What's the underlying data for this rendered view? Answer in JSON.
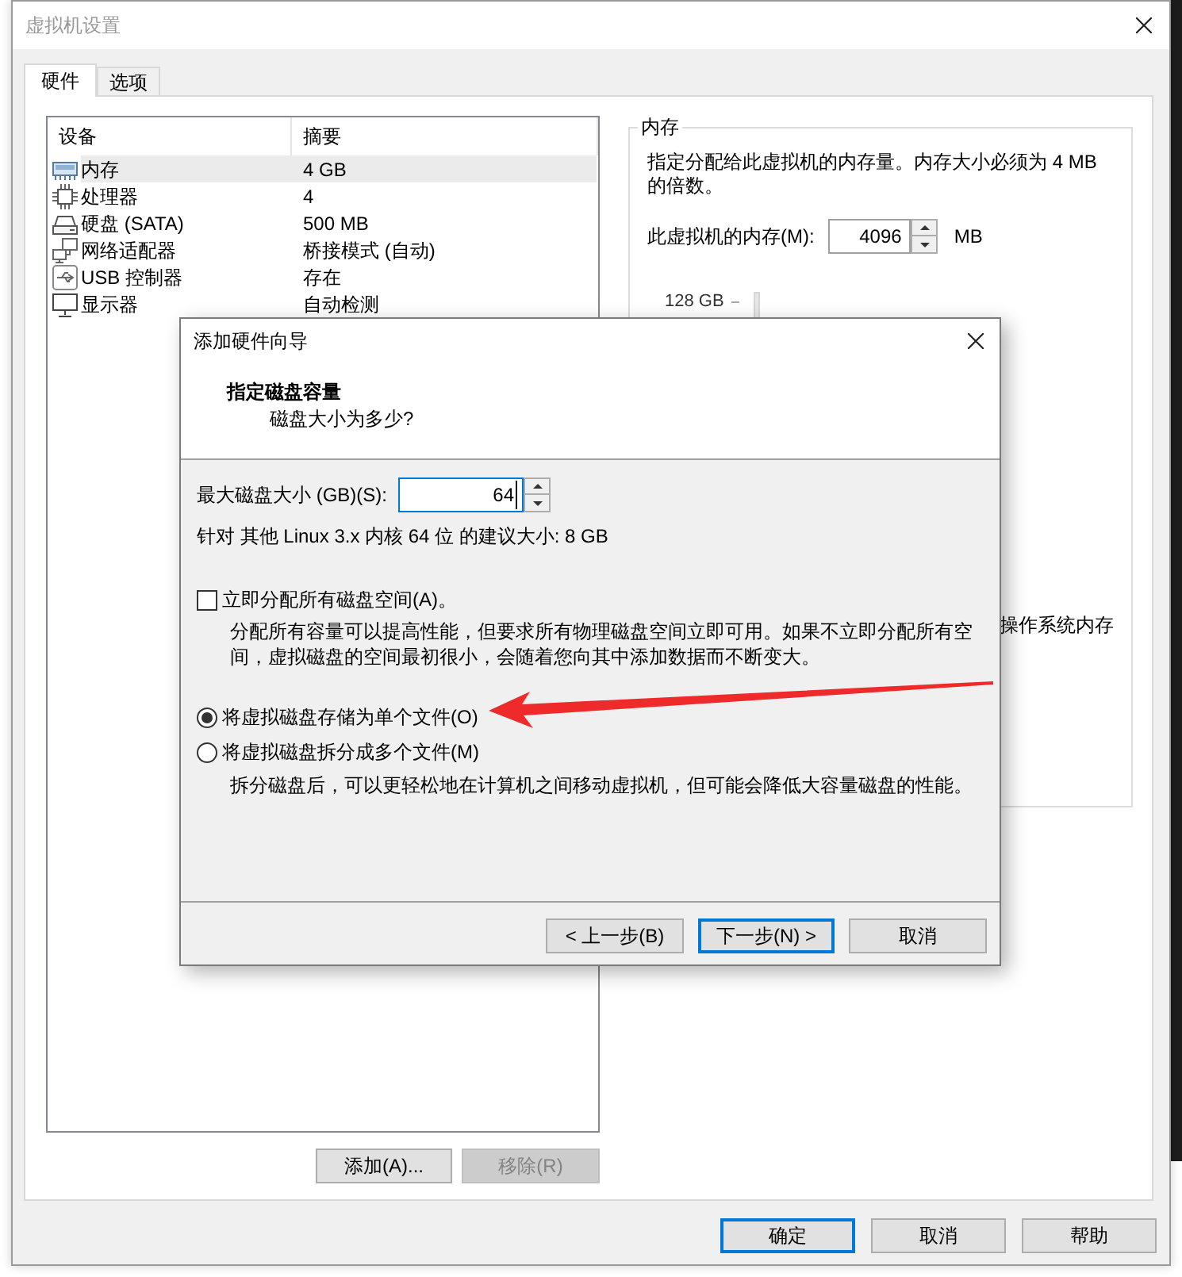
{
  "window": {
    "title": "虚拟机设置"
  },
  "tabs": [
    {
      "label": "硬件",
      "selected": true
    },
    {
      "label": "选项",
      "selected": false
    }
  ],
  "device_table": {
    "columns": [
      "设备",
      "摘要"
    ],
    "rows": [
      {
        "kind": "memory",
        "device": "内存",
        "summary": "4 GB",
        "selected": true
      },
      {
        "kind": "processor",
        "device": "处理器",
        "summary": "4",
        "selected": false
      },
      {
        "kind": "disk",
        "device": "硬盘 (SATA)",
        "summary": "500 MB",
        "selected": false
      },
      {
        "kind": "network",
        "device": "网络适配器",
        "summary": "桥接模式 (自动)",
        "selected": false
      },
      {
        "kind": "usb",
        "device": "USB 控制器",
        "summary": "存在",
        "selected": false
      },
      {
        "kind": "display",
        "device": "显示器",
        "summary": "自动检测",
        "selected": false
      }
    ]
  },
  "device_buttons": [
    {
      "label": "添加(A)...",
      "disabled": false
    },
    {
      "label": "移除(R)",
      "disabled": true
    }
  ],
  "memory_panel": {
    "title": "内存",
    "description": "指定分配给此虚拟机的内存量。内存大小必须为 4 MB 的倍数。",
    "field_label": "此虚拟机的内存(M):",
    "field": {
      "value": "4096",
      "focused": false
    },
    "unit": "MB",
    "scale_label": "128 GB",
    "note": "操作系统内存"
  },
  "buttons": [
    {
      "label": "确定",
      "default": true
    },
    {
      "label": "取消",
      "default": false
    },
    {
      "label": "帮助",
      "default": false
    }
  ],
  "dialog": {
    "title": "添加硬件向导",
    "heading": "指定磁盘容量",
    "subheading": "磁盘大小为多少?",
    "size_label": "最大磁盘大小 (GB)(S):",
    "size_field": {
      "value": "64",
      "focused": true
    },
    "recommendation": "针对 其他 Linux 3.x 内核 64 位 的建议大小: 8 GB",
    "allocate": {
      "label": "立即分配所有磁盘空间(A)。",
      "checked": false,
      "description": "分配所有容量可以提高性能，但要求所有物理磁盘空间立即可用。如果不立即分配所有空间，虚拟磁盘的空间最初很小，会随着您向其中添加数据而不断变大。"
    },
    "storage_options": [
      {
        "label": "将虚拟磁盘存储为单个文件(O)",
        "selected": true
      },
      {
        "label": "将虚拟磁盘拆分成多个文件(M)",
        "selected": false,
        "description": "拆分磁盘后，可以更轻松地在计算机之间移动虚拟机，但可能会降低大容量磁盘的性能。"
      }
    ],
    "buttons": [
      {
        "label": "< 上一步(B)",
        "default": false
      },
      {
        "label": "下一步(N) >",
        "default": true
      },
      {
        "label": "取消",
        "default": false
      }
    ]
  },
  "annotations": [
    {
      "kind": "arrow"
    }
  ]
}
